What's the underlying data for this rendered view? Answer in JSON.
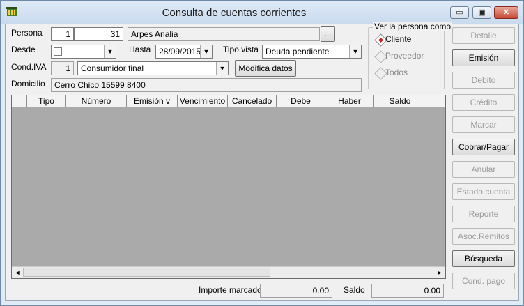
{
  "window": {
    "title": "Consulta de cuentas corrientes",
    "minimize": "▭",
    "maximize": "▣",
    "close": "✕"
  },
  "persona": {
    "label": "Persona",
    "sub_id": "1",
    "id": "31",
    "name": "Arpes Analia",
    "lookup": "..."
  },
  "desde": {
    "label": "Desde",
    "value": ""
  },
  "hasta": {
    "label": "Hasta",
    "value": "28/09/2015"
  },
  "tipo_vista": {
    "label": "Tipo vista",
    "value": "Deuda pendiente"
  },
  "cond_iva": {
    "label": "Cond.IVA",
    "code": "1",
    "value": "Consumidor final"
  },
  "modifica_datos": "Modifica datos",
  "domicilio": {
    "label": "Domicilio",
    "value": "Cerro Chico 15599  8400"
  },
  "ver_persona": {
    "title": "Ver la persona como",
    "options": [
      "Cliente",
      "Proveedor",
      "Todos"
    ],
    "selected": "Cliente"
  },
  "actions": [
    {
      "label": "Detalle",
      "enabled": false
    },
    {
      "label": "Emisión",
      "enabled": true
    },
    {
      "label": "Debito",
      "enabled": false
    },
    {
      "label": "Crédito",
      "enabled": false
    },
    {
      "label": "Marcar",
      "enabled": false
    },
    {
      "label": "Cobrar/Pagar",
      "enabled": true
    },
    {
      "label": "Anular",
      "enabled": false
    },
    {
      "label": "Estado cuenta",
      "enabled": false
    },
    {
      "label": "Reporte",
      "enabled": false
    },
    {
      "label": "Asoc.Remitos",
      "enabled": false
    },
    {
      "label": "Búsqueda",
      "enabled": true
    },
    {
      "label": "Cond. pago",
      "enabled": false
    }
  ],
  "table": {
    "columns": [
      "",
      "Tipo",
      "Número",
      "Emisión   v",
      "Vencimiento",
      "Cancelado",
      "Debe",
      "Haber",
      "Saldo",
      ""
    ]
  },
  "footer": {
    "importe_label": "Importe marcado",
    "importe_value": "0.00",
    "saldo_label": "Saldo",
    "saldo_value": "0.00"
  },
  "icons": {
    "dropdown": "▼",
    "scroll_left": "◄",
    "scroll_right": "►"
  }
}
